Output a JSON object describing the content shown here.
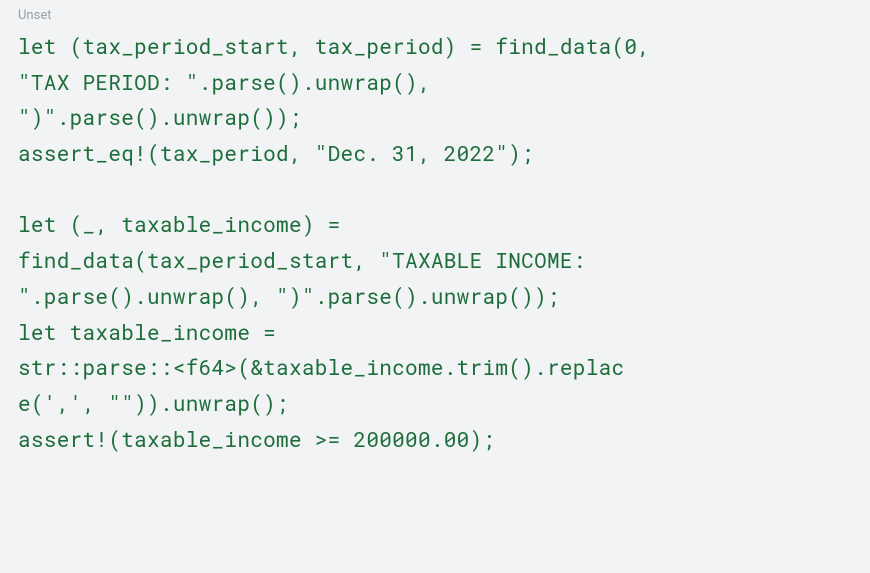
{
  "label": "Unset",
  "code": {
    "line1": "let (tax_period_start, tax_period) = find_data(0,",
    "line2": "\"TAX PERIOD: \".parse().unwrap(),",
    "line3": "\")\".parse().unwrap());",
    "line4": "assert_eq!(tax_period, \"Dec. 31, 2022\");",
    "line5": "",
    "line6": "let (_, taxable_income) =",
    "line7": "find_data(tax_period_start, \"TAXABLE INCOME:",
    "line8": "\".parse().unwrap(), \")\".parse().unwrap());",
    "line9": "let taxable_income =",
    "line10": "str::parse::<f64>(&taxable_income.trim().replac",
    "line11": "e(',', \"\")).unwrap();",
    "line12": "assert!(taxable_income >= 200000.00);"
  }
}
